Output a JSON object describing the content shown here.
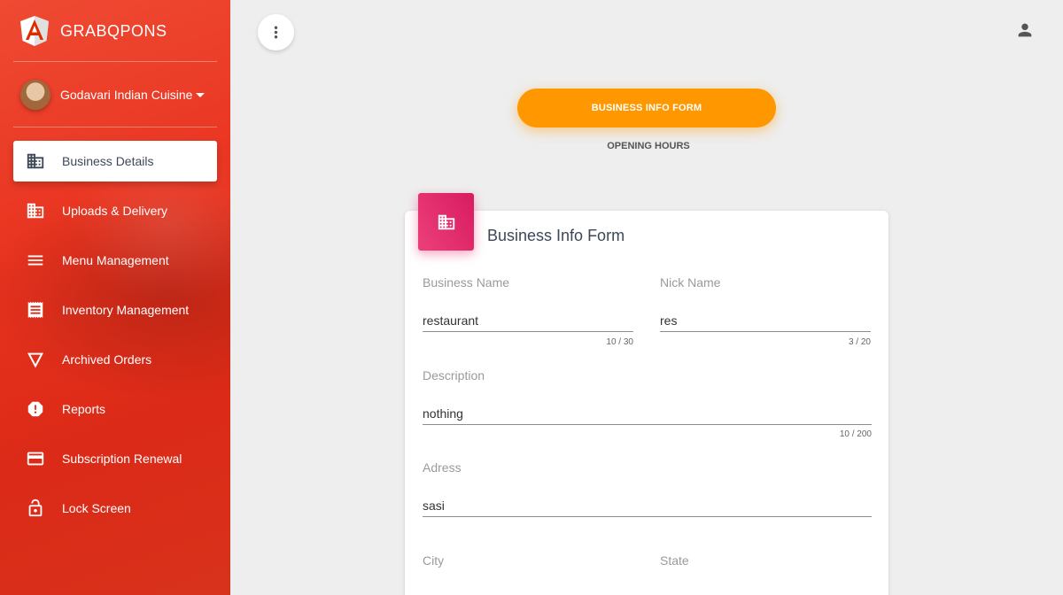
{
  "sidebar": {
    "brand": "GRABQPONS",
    "user_name": "Godavari Indian Cuisine",
    "items": [
      {
        "label": "Business Details",
        "icon": "building-icon",
        "active": true
      },
      {
        "label": "Uploads & Delivery",
        "icon": "building-icon",
        "active": false
      },
      {
        "label": "Menu Management",
        "icon": "menu-lines-icon",
        "active": false
      },
      {
        "label": "Inventory Management",
        "icon": "receipt-icon",
        "active": false
      },
      {
        "label": "Archived Orders",
        "icon": "triangle-down-icon",
        "active": false
      },
      {
        "label": "Reports",
        "icon": "alert-octagon-icon",
        "active": false
      },
      {
        "label": "Subscription Renewal",
        "icon": "credit-card-icon",
        "active": false
      },
      {
        "label": "Lock Screen",
        "icon": "lock-icon",
        "active": false
      }
    ]
  },
  "tabs": {
    "active": "BUSINESS INFO FORM",
    "inactive": "OPENING HOURS"
  },
  "form": {
    "title": "Business Info Form",
    "business_name": {
      "label": "Business Name",
      "value": "restaurant",
      "count": "10 / 30"
    },
    "nick_name": {
      "label": "Nick Name",
      "value": "res",
      "count": "3 / 20"
    },
    "description": {
      "label": "Description",
      "value": "nothing",
      "count": "10 / 200"
    },
    "address": {
      "label": "Adress",
      "value": "sasi"
    },
    "city": {
      "label": "City",
      "value": ""
    },
    "state": {
      "label": "State",
      "value": ""
    }
  },
  "colors": {
    "sidebar": "#e8331f",
    "accent_orange": "#ff9800",
    "accent_pink": "#e91e63"
  }
}
